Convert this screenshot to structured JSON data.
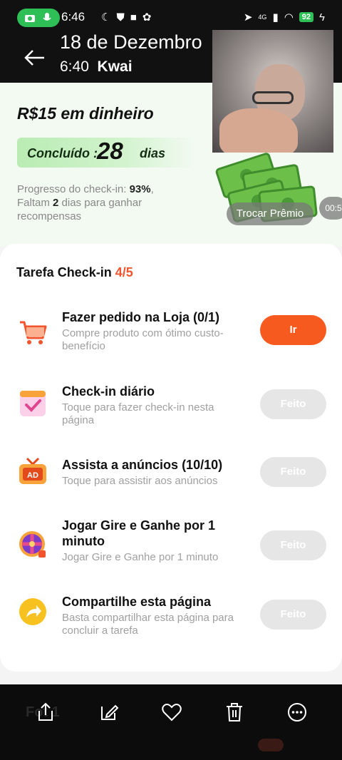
{
  "status_bar": {
    "time": "6:46",
    "network": "4G",
    "battery": "92"
  },
  "media_header": {
    "title": "18 de Dezembro",
    "time": "6:40",
    "app_name": "Kwai"
  },
  "hero": {
    "reward_title": "R$15 em dinheiro",
    "completed_label": "Concluído :",
    "completed_days": "28",
    "completed_unit": "dias",
    "progress_prefix": "Progresso do check-in: ",
    "progress_percent": "93%",
    "progress_middle": ", Faltam ",
    "days_left": "2",
    "progress_suffix": " dias para ganhar recompensas",
    "exchange_button": "Trocar Prêmio",
    "timer": "00:5"
  },
  "tasks_card": {
    "title": "Tarefa Check-in ",
    "count": "4/5",
    "tasks": [
      {
        "title": "Fazer pedido na Loja  (0/1)",
        "desc": "Compre produto com ótimo custo-benefício",
        "button": "Ir",
        "status": "go",
        "icon": "shopping-cart-icon"
      },
      {
        "title": "Check-in diário",
        "desc": "Toque para fazer check-in nesta página",
        "button": "Feito",
        "status": "done",
        "icon": "calendar-check-icon"
      },
      {
        "title": "Assista a anúncios  (10/10)",
        "desc": "Toque para assistir aos anúncios",
        "button": "Feito",
        "status": "done",
        "icon": "ad-tv-icon"
      },
      {
        "title": "Jogar Gire e Ganhe por 1 minuto",
        "desc": "Jogar Gire e Ganhe por 1 minuto",
        "button": "Feito",
        "status": "done",
        "icon": "spin-wheel-icon"
      },
      {
        "title": "Compartilhe esta página",
        "desc": "Basta compartilhar esta página para concluir a tarefa",
        "button": "Feito",
        "status": "done",
        "icon": "share-arrow-icon"
      }
    ]
  },
  "toolbar": {
    "items": [
      "share-icon",
      "edit-icon",
      "heart-icon",
      "trash-icon",
      "more-icon"
    ],
    "ghost_label": "Fot 1"
  },
  "colors": {
    "accent_orange": "#f75a1e",
    "done_gray": "#e6e6e6",
    "count_red": "#f2542d"
  }
}
